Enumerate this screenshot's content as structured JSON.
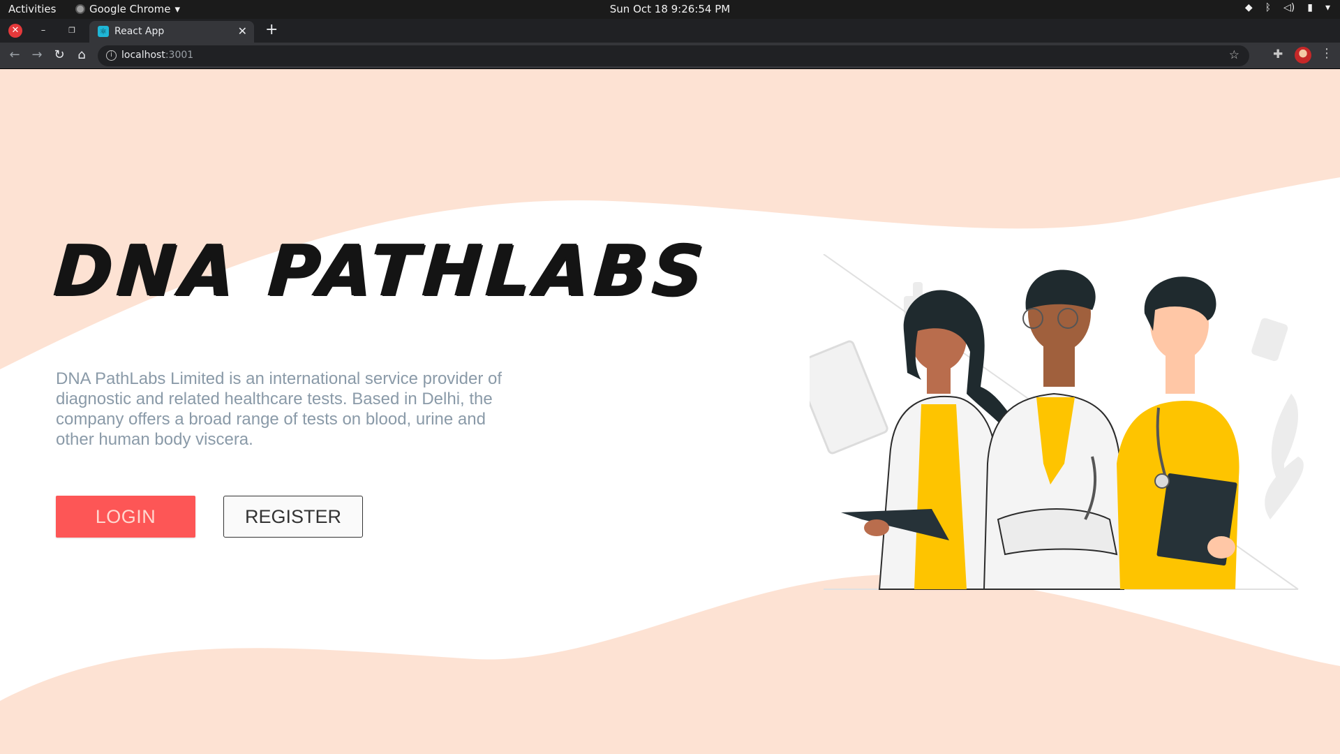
{
  "system_bar": {
    "activities": "Activities",
    "app_name": "Google Chrome",
    "clock": "Sun Oct 18  9:26:54 PM",
    "tray_icons": [
      "wifi-icon",
      "bluetooth-icon",
      "volume-icon",
      "battery-icon",
      "chevron-down-icon"
    ]
  },
  "browser": {
    "tab_title": "React App",
    "favicon": "react-icon",
    "url_host": "localhost",
    "url_port": ":3001"
  },
  "page": {
    "brand_title": "DNA PATHLABS",
    "description": "DNA PathLabs Limited is an international service provider of diagnostic and related healthcare tests. Based in Delhi, the company offers a broad range of tests on blood, urine and other human body viscera.",
    "login_label": "LOGIN",
    "register_label": "REGISTER",
    "illustration": "three-doctors-illustration"
  },
  "colors": {
    "background_peach": "#fde2d3",
    "wave_white": "#ffffff",
    "login_red": "#fd5656",
    "description_text": "#8a9aa8",
    "accent_yellow": "#fec400"
  }
}
